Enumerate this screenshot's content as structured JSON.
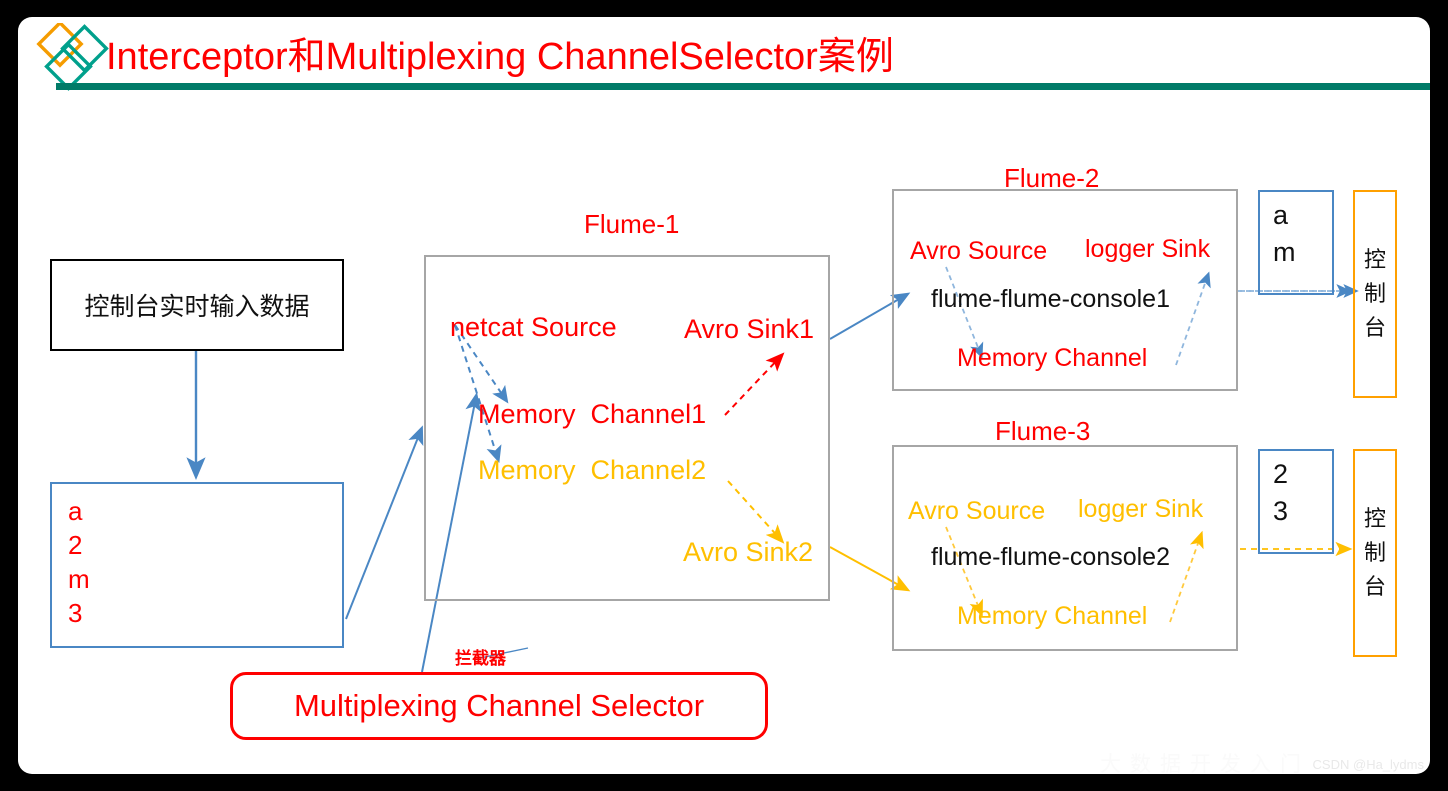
{
  "page": {
    "background": "#000000",
    "panel_background": "#ffffff"
  },
  "header": {
    "title": "Interceptor和Multiplexing ChannelSelector案例",
    "title_color": "#ff0000",
    "rule_color": "#017b68",
    "logo": {
      "name": "diamond-logo",
      "colors": [
        "#f59c00",
        "#00a08c",
        "#00a08c"
      ]
    }
  },
  "colors": {
    "red": "#ff0000",
    "orange": "#ffbf00",
    "blue": "#4a87c4",
    "gray": "#a6a6a6",
    "black": "#000000",
    "teal": "#017b68"
  },
  "input": {
    "console_box_label": "控制台实时输入数据",
    "data_lines": [
      "a",
      "2",
      "m",
      "3"
    ]
  },
  "flume1": {
    "title": "Flume-1",
    "source": "netcat Source",
    "channel1": "Memory  Channel1",
    "channel2": "Memory  Channel2",
    "sink1": "Avro Sink1",
    "sink2": "Avro Sink2"
  },
  "flume2": {
    "title": "Flume-2",
    "source": "Avro Source",
    "sink": "logger Sink",
    "agent_name": "flume-flume-console1",
    "channel": "Memory Channel"
  },
  "flume3": {
    "title": "Flume-3",
    "source": "Avro Source",
    "sink": "logger Sink",
    "agent_name": "flume-flume-console2",
    "channel": "Memory Channel"
  },
  "outputs": [
    {
      "name": "output-1",
      "data_lines": [
        "a",
        "m"
      ],
      "console_label": "控制台",
      "console_chars": [
        "控",
        "制",
        "台"
      ]
    },
    {
      "name": "output-2",
      "data_lines": [
        "2",
        "3"
      ],
      "console_label": "控制台",
      "console_chars": [
        "控",
        "制",
        "台"
      ]
    }
  ],
  "selector": {
    "callout_label": "拦截器",
    "box_label": "Multiplexing Channel Selector"
  },
  "watermark": {
    "text": "CSDN @Ha_lydms",
    "cn_text": "大数据开发入门"
  }
}
